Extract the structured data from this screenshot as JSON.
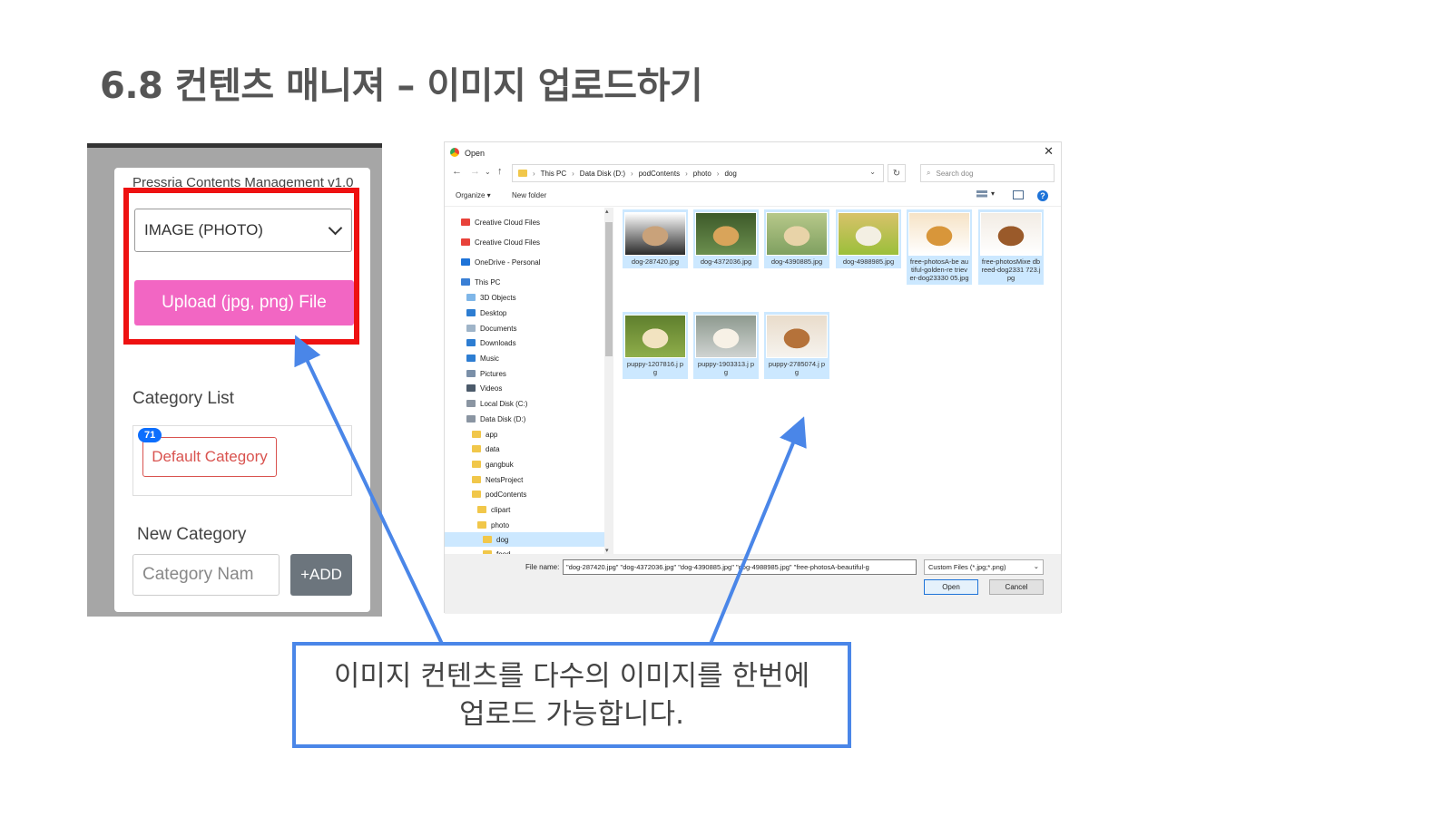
{
  "slide": {
    "title": "6.8  컨텐츠 매니져 – 이미지 업로드하기"
  },
  "app": {
    "heading": "Pressria Contents Management v1.0",
    "type_select": {
      "value": "IMAGE (PHOTO)"
    },
    "upload_button": "Upload (jpg, png) File",
    "category_list_label": "Category List",
    "categories": [
      {
        "name": "Default Category",
        "count": "71"
      }
    ],
    "new_category_label": "New Category",
    "new_category_placeholder": "Category Nam",
    "add_button": "+ADD",
    "colors": {
      "upload": "#f266c3",
      "highlight_border": "#ee1111",
      "add": "#6c757d",
      "badge": "#0d6efd"
    }
  },
  "dialog": {
    "title": "Open",
    "close_icon": "close-icon",
    "breadcrumb": [
      "This PC",
      "Data Disk (D:)",
      "podContents",
      "photo",
      "dog"
    ],
    "search_placeholder": "Search dog",
    "toolbar": {
      "organize": "Organize ▾",
      "new_folder": "New folder"
    },
    "nav_items": [
      {
        "label": "Creative Cloud Files",
        "icon": "creative-cloud-icon",
        "indent": 0,
        "selected": false
      },
      {
        "label": "Creative Cloud Files",
        "icon": "creative-cloud-icon",
        "indent": 0,
        "selected": false
      },
      {
        "label": "OneDrive - Personal",
        "icon": "onedrive-icon",
        "indent": 0,
        "selected": false
      },
      {
        "label": "This PC",
        "icon": "computer-icon",
        "indent": 0,
        "selected": false
      },
      {
        "label": "3D Objects",
        "icon": "3d-objects-icon",
        "indent": 1,
        "selected": false
      },
      {
        "label": "Desktop",
        "icon": "desktop-icon",
        "indent": 1,
        "selected": false
      },
      {
        "label": "Documents",
        "icon": "documents-icon",
        "indent": 1,
        "selected": false
      },
      {
        "label": "Downloads",
        "icon": "downloads-icon",
        "indent": 1,
        "selected": false
      },
      {
        "label": "Music",
        "icon": "music-icon",
        "indent": 1,
        "selected": false
      },
      {
        "label": "Pictures",
        "icon": "pictures-icon",
        "indent": 1,
        "selected": false
      },
      {
        "label": "Videos",
        "icon": "videos-icon",
        "indent": 1,
        "selected": false
      },
      {
        "label": "Local Disk (C:)",
        "icon": "drive-icon",
        "indent": 1,
        "selected": false
      },
      {
        "label": "Data Disk (D:)",
        "icon": "drive-icon",
        "indent": 1,
        "selected": false
      },
      {
        "label": "app",
        "icon": "folder-icon",
        "indent": 2,
        "selected": false
      },
      {
        "label": "data",
        "icon": "folder-icon",
        "indent": 2,
        "selected": false
      },
      {
        "label": "gangbuk",
        "icon": "folder-icon",
        "indent": 2,
        "selected": false
      },
      {
        "label": "NetsProject",
        "icon": "folder-icon",
        "indent": 2,
        "selected": false
      },
      {
        "label": "podContents",
        "icon": "folder-icon",
        "indent": 2,
        "selected": false
      },
      {
        "label": "clipart",
        "icon": "folder-icon",
        "indent": 3,
        "selected": false
      },
      {
        "label": "photo",
        "icon": "folder-icon",
        "indent": 3,
        "selected": false
      },
      {
        "label": "dog",
        "icon": "folder-icon",
        "indent": 4,
        "selected": true
      },
      {
        "label": "food",
        "icon": "folder-icon",
        "indent": 4,
        "selected": false
      }
    ],
    "files": [
      {
        "name": "dog-287420.jpg",
        "colors": [
          "#2a2a2a",
          "#c9a27a",
          "#ffffff"
        ]
      },
      {
        "name": "dog-4372036.jpg",
        "colors": [
          "#6b8f4e",
          "#d9a45a",
          "#3d5a2a"
        ]
      },
      {
        "name": "dog-4390885.jpg",
        "colors": [
          "#7fa060",
          "#e8d3a8",
          "#b7c88a"
        ]
      },
      {
        "name": "dog-4988985.jpg",
        "colors": [
          "#9bbf3a",
          "#f3efe3",
          "#d8c26a"
        ]
      },
      {
        "name": "free-photosA-beautiful-golden-retriever-dog2333005.jpg",
        "colors": [
          "#ffffff",
          "#d8963a",
          "#f6e3c6"
        ]
      },
      {
        "name": "free-photosMixedbreed-dog2331723.jpg",
        "colors": [
          "#ffffff",
          "#9a5a2a",
          "#f2ece4"
        ]
      },
      {
        "name": "puppy-1207816.jpg",
        "colors": [
          "#8fae4a",
          "#f2e3c0",
          "#5f7f2e"
        ]
      },
      {
        "name": "puppy-1903313.jpg",
        "colors": [
          "#cfd3d1",
          "#f7f1e6",
          "#8e9a8f"
        ]
      },
      {
        "name": "puppy-2785074.jpg",
        "colors": [
          "#f6f3ee",
          "#b5723a",
          "#e9dccb"
        ]
      }
    ],
    "file_labels_display": [
      "dog-287420.jpg",
      "dog-4372036.jpg",
      "dog-4390885.jpg",
      "dog-4988985.jpg",
      "free-photosA-be autiful-golden-re triever-dog23330 05.jpg",
      "free-photosMixe dbreed-dog2331 723.jpg",
      "puppy-1207816.j pg",
      "puppy-1903313.j pg",
      "puppy-2785074.j pg"
    ],
    "file_name_label": "File name:",
    "file_name_value": "\"dog-287420.jpg\" \"dog-4372036.jpg\" \"dog-4390885.jpg\" \"dog-4988985.jpg\" \"free-photosA-beautiful-g",
    "file_type": "Custom Files (*.jpg;*.png)",
    "open_button": "Open",
    "cancel_button": "Cancel"
  },
  "callout": {
    "line1": "이미지 컨텐츠를 다수의 이미지를 한번에",
    "line2": "업로드 가능합니다.",
    "color": "#4a86e8"
  }
}
